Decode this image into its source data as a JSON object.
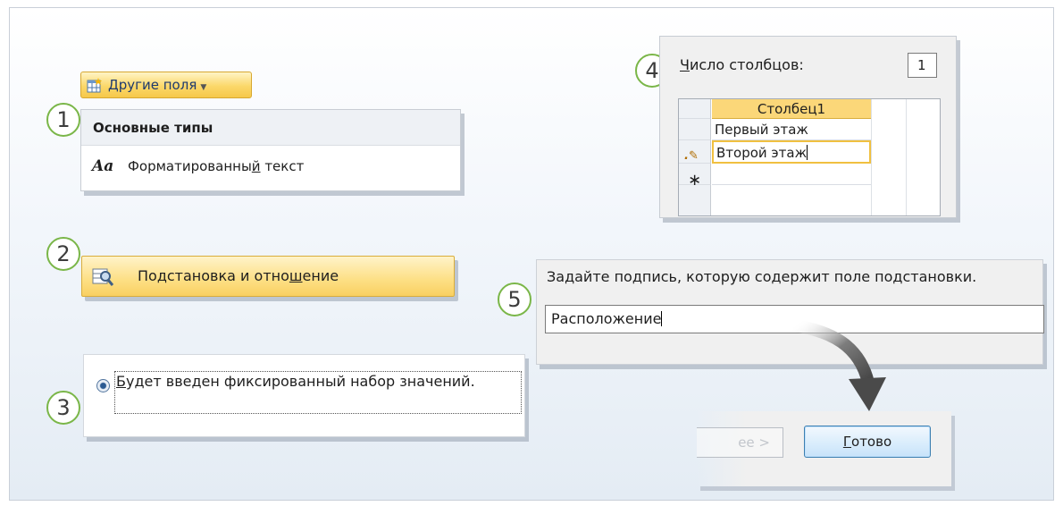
{
  "callouts": [
    "1",
    "2",
    "3",
    "4",
    "5"
  ],
  "step1": {
    "ribbon_button": {
      "label": "Другие поля",
      "icon": "table-add-icon",
      "dropdown_icon": "chevron-down-icon"
    },
    "menu_header": "Основные типы",
    "menu_item": {
      "icon": "rich-text-icon",
      "icon_text": "Aa",
      "label_pre": "Форматированны",
      "label_u": "й",
      "label_post": " текст"
    }
  },
  "step2": {
    "icon": "lookup-relationship-icon",
    "label_pre": "Подстановка и отно",
    "label_u": "ш",
    "label_post": "ение"
  },
  "step3": {
    "radio_checked": true,
    "label_u": "Б",
    "label_post": "удет введен фиксированный набор значений."
  },
  "step4": {
    "count_label_u": "Ч",
    "count_label_post": "исло столбцов:",
    "count_value": "1",
    "grid": {
      "column_header": "Столбец1",
      "rows": [
        "Первый этаж",
        "Второй этаж"
      ],
      "edit_row_icon": "pencil-icon",
      "new_row_icon": "asterisk-icon"
    }
  },
  "step5": {
    "prompt": "Задайте подпись, которую содержит поле подстановки.",
    "value": "Расположение"
  },
  "buttons": {
    "next_label": "ее >",
    "done_label_u": "Г",
    "done_label_post": "отово"
  },
  "colors": {
    "callout_border": "#7ab648",
    "highlight": "#fbd779",
    "button_border": "#3c7fb1"
  }
}
